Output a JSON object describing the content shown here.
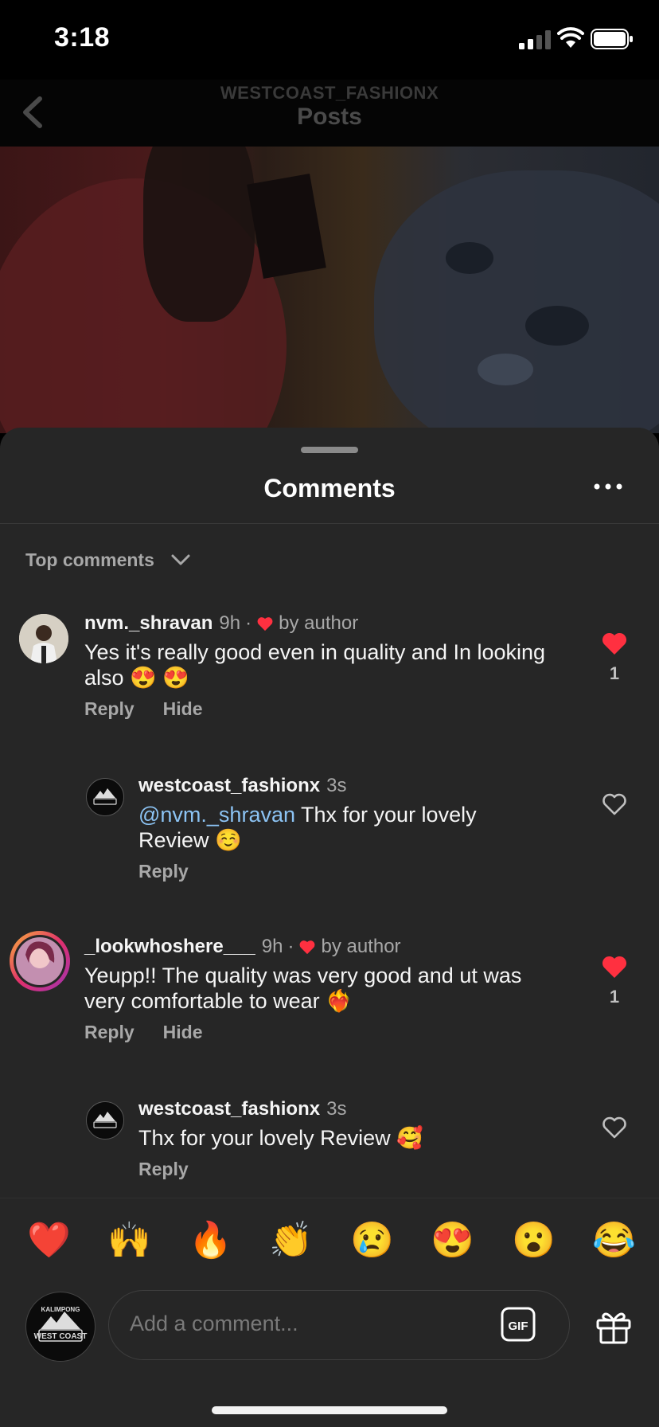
{
  "status": {
    "time": "3:18"
  },
  "header": {
    "account": "WESTCOAST_FASHIONX",
    "title": "Posts"
  },
  "sheet": {
    "title": "Comments",
    "sort_label": "Top comments"
  },
  "comments": [
    {
      "username": "nvm._shravan",
      "time": "9h",
      "liked_by_author_text": "by author",
      "text": "Yes it's really good even in quality and In looking also 😍 😍",
      "reply_label": "Reply",
      "hide_label": "Hide",
      "like_count": "1",
      "liked": true
    },
    {
      "username": "westcoast_fashionx",
      "time": "3s",
      "mention": "@nvm._shravan",
      "text": " Thx for your lovely Review ☺️",
      "reply_label": "Reply",
      "liked": false
    },
    {
      "username": "_lookwhoshere___",
      "time": "9h",
      "liked_by_author_text": "by author",
      "text": "Yeupp!! The quality was very good and ut was very comfortable to wear ❤️‍🔥",
      "reply_label": "Reply",
      "hide_label": "Hide",
      "like_count": "1",
      "liked": true
    },
    {
      "username": "westcoast_fashionx",
      "time": "3s",
      "text": "Thx for your lovely Review 🥰",
      "reply_label": "Reply",
      "liked": false
    }
  ],
  "reactions": [
    "❤️",
    "🙌",
    "🔥",
    "👏",
    "😢",
    "😍",
    "😮",
    "😂"
  ],
  "composer": {
    "placeholder": "Add a comment...",
    "gif_label": "GIF",
    "avatar_text_top": "KALIMPONG",
    "avatar_text": "WEST COAST"
  },
  "colors": {
    "like_red": "#ff3040",
    "mention_blue": "#8cc3f3",
    "sheet_bg": "#262626"
  }
}
